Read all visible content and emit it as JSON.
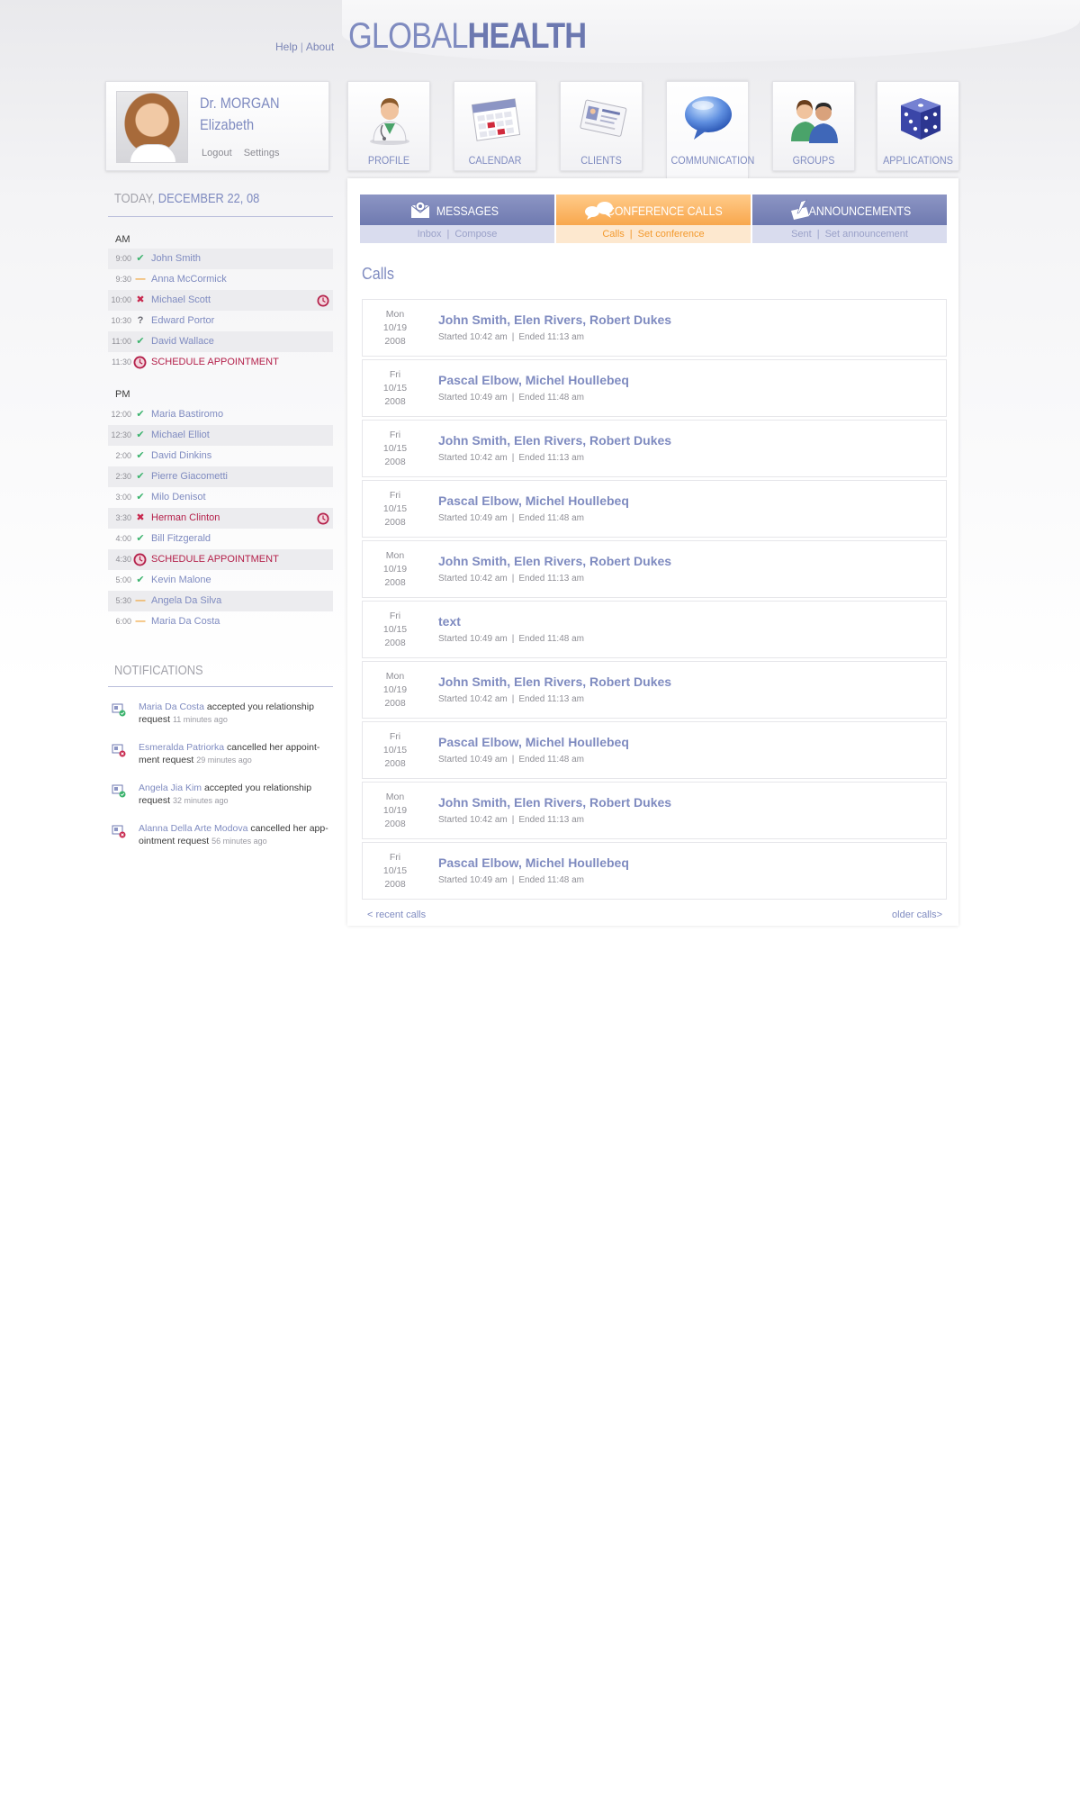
{
  "header": {
    "links": [
      "Help",
      "About"
    ],
    "brand_light": "GLOBAL",
    "brand_bold": "HEALTH"
  },
  "profile": {
    "name_line1": "Dr. MORGAN",
    "name_line2": "Elizabeth",
    "logout": "Logout",
    "settings": "Settings"
  },
  "nav": [
    {
      "label": "PROFILE",
      "icon": "doctor-icon"
    },
    {
      "label": "CALENDAR",
      "icon": "calendar-icon"
    },
    {
      "label": "CLIENTS",
      "icon": "contact-card-icon"
    },
    {
      "label": "COMMUNICATION",
      "icon": "speech-bubble-icon",
      "active": true
    },
    {
      "label": "GROUPS",
      "icon": "people-icon"
    },
    {
      "label": "APPLICATIONS",
      "icon": "dice-icon"
    }
  ],
  "today": {
    "prefix": "TODAY,",
    "date": "DECEMBER 22, 08"
  },
  "schedule": {
    "am_label": "AM",
    "pm_label": "PM",
    "am": [
      {
        "time": "9:00",
        "status": "ok",
        "name": "John Smith"
      },
      {
        "time": "9:30",
        "status": "pending",
        "name": "Anna McCormick"
      },
      {
        "time": "10:00",
        "status": "cancelled",
        "name": "Michael Scott",
        "alarm": true
      },
      {
        "time": "10:30",
        "status": "unknown",
        "name": "Edward Portor"
      },
      {
        "time": "11:00",
        "status": "ok",
        "name": "David Wallace"
      },
      {
        "time": "11:30",
        "status": "schedule",
        "name": "SCHEDULE APPOINTMENT"
      }
    ],
    "pm": [
      {
        "time": "12:00",
        "status": "ok",
        "name": "Maria Bastiromo"
      },
      {
        "time": "12:30",
        "status": "ok",
        "name": "Michael Elliot"
      },
      {
        "time": "2:00",
        "status": "ok",
        "name": "David Dinkins"
      },
      {
        "time": "2:30",
        "status": "ok",
        "name": "Pierre Giacometti"
      },
      {
        "time": "3:00",
        "status": "ok",
        "name": "Milo Denisot"
      },
      {
        "time": "3:30",
        "status": "cancelled",
        "name": "Herman Clinton",
        "alarm": true
      },
      {
        "time": "4:00",
        "status": "ok",
        "name": "Bill Fitzgerald"
      },
      {
        "time": "4:30",
        "status": "schedule",
        "name": "SCHEDULE APPOINTMENT"
      },
      {
        "time": "5:00",
        "status": "ok",
        "name": "Kevin Malone"
      },
      {
        "time": "5:30",
        "status": "pending",
        "name": "Angela Da Silva"
      },
      {
        "time": "6:00",
        "status": "pending",
        "name": "Maria Da Costa"
      }
    ]
  },
  "notifications": {
    "title": "NOTIFICATIONS",
    "items": [
      {
        "type": "accepted",
        "person": "Maria Da Costa",
        "text_a": " accepted you relationship",
        "text_b": "request ",
        "ago": "11 minutes ago"
      },
      {
        "type": "cancelled",
        "person": "Esmeralda Patriorka",
        "text_a": " cancelled her appoint-",
        "text_b": "ment request ",
        "ago": "29 minutes ago"
      },
      {
        "type": "accepted",
        "person": "Angela Jia Kim",
        "text_a": " accepted you relationship",
        "text_b": "request ",
        "ago": "32 minutes ago"
      },
      {
        "type": "cancelled",
        "person": "Alanna Della Arte Modova",
        "text_a": " cancelled her app-",
        "text_b": "ointment request ",
        "ago": "56 minutes ago"
      }
    ]
  },
  "subtabs": [
    {
      "label": "MESSAGES",
      "icon": "envelope-icon",
      "links": [
        "Inbox",
        "Compose"
      ]
    },
    {
      "label": "CONFERENCE CALLS",
      "icon": "chat-bubbles-icon",
      "links": [
        "Calls",
        "Set conference"
      ],
      "active": true
    },
    {
      "label": "ANNOUNCEMENTS",
      "icon": "notepad-icon",
      "links": [
        "Sent",
        "Set announcement"
      ]
    }
  ],
  "calls": {
    "heading": "Calls",
    "started_prefix": "Started",
    "ended_prefix": "Ended",
    "items": [
      {
        "day": "Mon",
        "date": "10/19",
        "year": "2008",
        "names": "John Smith, Elen Rivers, Robert Dukes",
        "start": "10:42 am",
        "end": "11:13 am"
      },
      {
        "day": "Fri",
        "date": "10/15",
        "year": "2008",
        "names": "Pascal Elbow, Michel Houllebeq",
        "start": "10:49 am",
        "end": "11:48 am"
      },
      {
        "day": "Fri",
        "date": "10/15",
        "year": "2008",
        "names": "John Smith, Elen Rivers, Robert Dukes",
        "start": "10:42 am",
        "end": "11:13 am"
      },
      {
        "day": "Fri",
        "date": "10/15",
        "year": "2008",
        "names": "Pascal Elbow, Michel Houllebeq",
        "start": "10:49 am",
        "end": "11:48 am"
      },
      {
        "day": "Mon",
        "date": "10/19",
        "year": "2008",
        "names": "John Smith, Elen Rivers, Robert Dukes",
        "start": "10:42 am",
        "end": "11:13 am"
      },
      {
        "day": "Fri",
        "date": "10/15",
        "year": "2008",
        "names": "text",
        "start": "10:49 am",
        "end": "11:48 am"
      },
      {
        "day": "Mon",
        "date": "10/19",
        "year": "2008",
        "names": "John Smith, Elen Rivers, Robert Dukes",
        "start": "10:42 am",
        "end": "11:13 am"
      },
      {
        "day": "Fri",
        "date": "10/15",
        "year": "2008",
        "names": "Pascal Elbow, Michel Houllebeq",
        "start": "10:49 am",
        "end": "11:48 am"
      },
      {
        "day": "Mon",
        "date": "10/19",
        "year": "2008",
        "names": "John Smith, Elen Rivers, Robert Dukes",
        "start": "10:42 am",
        "end": "11:13 am"
      },
      {
        "day": "Fri",
        "date": "10/15",
        "year": "2008",
        "names": "Pascal Elbow, Michel Houllebeq",
        "start": "10:49 am",
        "end": "11:48 am"
      }
    ],
    "recent_label": "< recent calls",
    "older_label": "older calls>"
  },
  "colors": {
    "accent": "#7f8bc0",
    "active_tab": "#f8a74d",
    "ok": "#3bb36d",
    "cancelled": "#c8284e",
    "pending": "#f0a030"
  }
}
